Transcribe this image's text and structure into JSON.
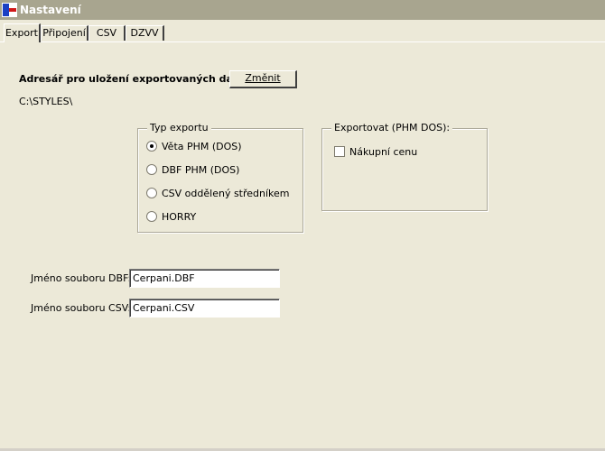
{
  "window": {
    "title": "Nastavení"
  },
  "tabs": [
    {
      "label": "Export",
      "active": true
    },
    {
      "label": "Připojení",
      "active": false
    },
    {
      "label": "CSV",
      "active": false
    },
    {
      "label": "DZVV",
      "active": false
    }
  ],
  "export": {
    "folder_label": "Adresář pro uložení exportovaných dat:",
    "change_button": "Změnit",
    "folder_path": "C:\\STYLES\\"
  },
  "export_type": {
    "title": "Typ exportu",
    "options": [
      {
        "label": "Věta PHM (DOS)",
        "checked": true
      },
      {
        "label": "DBF PHM (DOS)",
        "checked": false
      },
      {
        "label": "CSV oddělený středníkem",
        "checked": false
      },
      {
        "label": "HORRY",
        "checked": false
      }
    ]
  },
  "export_phm": {
    "title": "Exportovat (PHM DOS):",
    "purchase_price_label": "Nákupní cenu",
    "purchase_price_checked": false
  },
  "files": {
    "dbf_label": "Jméno souboru DBF:",
    "dbf_value": "Cerpani.DBF",
    "csv_label": "Jméno souboru CSV:",
    "csv_value": "Cerpani.CSV"
  }
}
